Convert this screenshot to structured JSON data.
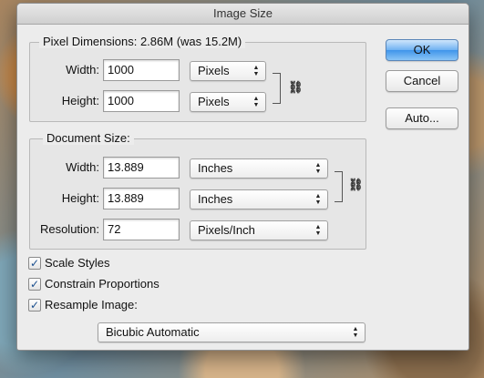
{
  "window": {
    "title": "Image Size"
  },
  "pixel_dimensions": {
    "title": "Pixel Dimensions:",
    "size_text": "2.86M (was 15.2M)",
    "width_label": "Width:",
    "width_value": "1000",
    "width_unit": "Pixels",
    "height_label": "Height:",
    "height_value": "1000",
    "height_unit": "Pixels"
  },
  "document_size": {
    "title": "Document Size:",
    "width_label": "Width:",
    "width_value": "13.889",
    "width_unit": "Inches",
    "height_label": "Height:",
    "height_value": "13.889",
    "height_unit": "Inches",
    "resolution_label": "Resolution:",
    "resolution_value": "72",
    "resolution_unit": "Pixels/Inch"
  },
  "options": {
    "scale_styles": {
      "label": "Scale Styles",
      "checked": true
    },
    "constrain_proportions": {
      "label": "Constrain Proportions",
      "checked": true
    },
    "resample_image": {
      "label": "Resample Image:",
      "checked": true
    },
    "resample_method": "Bicubic Automatic"
  },
  "buttons": {
    "ok": "OK",
    "cancel": "Cancel",
    "auto": "Auto..."
  },
  "icons": {
    "link": "chain-link-icon",
    "check": "checkmark-icon",
    "arrows": "up-down-arrows-icon"
  },
  "colors": {
    "primary_button": "#4a9cec",
    "dialog_bg": "#ececec"
  }
}
